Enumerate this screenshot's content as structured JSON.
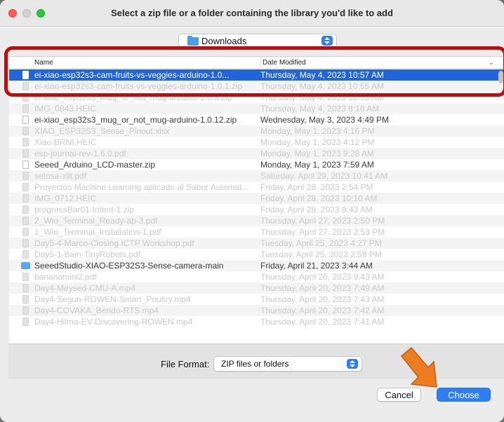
{
  "dialog": {
    "title": "Select a zip file or a folder containing the library you'd like to add"
  },
  "location": {
    "selected": "Downloads",
    "icon": "folder-icon"
  },
  "columns": {
    "name": "Name",
    "date": "Date Modified"
  },
  "files": [
    {
      "name": "ei-xiao-esp32s3-cam-fruits-vs-veggies-arduino-1.0...",
      "date": "Thursday, May 4, 2023 10:57 AM",
      "state": "selected",
      "icon": "zip-file-icon"
    },
    {
      "name": "ei-xiao-esp32s3-cam-fruits-vs-veggies-arduino-1.0.1.zip",
      "date": "Thursday, May 4, 2023 10:55 AM",
      "state": "disabled",
      "icon": "zip-file-icon"
    },
    {
      "name": "ei-xiao_esp32s3_mug_or_not_mug-arduino-1.0.8.zip",
      "date": "Thursday, May 4, 2023 10:53 AM",
      "state": "disabled",
      "icon": "zip-file-icon"
    },
    {
      "name": "IMG_0843.HEIC",
      "date": "Thursday, May 4, 2023 8:18 AM",
      "state": "disabled",
      "icon": "image-file-icon"
    },
    {
      "name": "ei-xiao_esp32s3_mug_or_not_mug-arduino-1.0.12.zip",
      "date": "Wednesday, May 3, 2023 4:49 PM",
      "state": "enabled",
      "icon": "zip-file-icon"
    },
    {
      "name": "XIAO_ESP32S3_Sense_Pinout.xlsx",
      "date": "Monday, May 1, 2023 4:16 PM",
      "state": "disabled",
      "icon": "spreadsheet-file-icon"
    },
    {
      "name": "Xiao-BRNI.HEIC",
      "date": "Monday, May 1, 2023 4:12 PM",
      "state": "disabled",
      "icon": "image-file-icon"
    },
    {
      "name": "esp-journal-rev-1.6.0.pdf",
      "date": "Monday, May 1, 2023 9:28 AM",
      "state": "disabled",
      "icon": "pdf-file-icon"
    },
    {
      "name": "Seeed_Arduino_LCD-master.zip",
      "date": "Monday, May 1, 2023 7:59 AM",
      "state": "enabled",
      "icon": "zip-file-icon"
    },
    {
      "name": "setosa-xiit.pdf",
      "date": "Saturday, April 29, 2023 10:41 AM",
      "state": "disabled",
      "icon": "pdf-file-icon"
    },
    {
      "name": "Proyectos Machine Learning aplicado al Sabor Automat...",
      "date": "Friday, April 28, 2023 2:54 PM",
      "state": "disabled",
      "icon": "document-file-icon"
    },
    {
      "name": "IMG_0712.HEIC",
      "date": "Friday, April 28, 2023 10:10 AM",
      "state": "disabled",
      "icon": "image-file-icon"
    },
    {
      "name": "progressBar01-Intent-1.zip",
      "date": "Friday, April 28, 2023 9:43 AM",
      "state": "disabled",
      "icon": "zip-file-icon"
    },
    {
      "name": "2_Wio_Terminal_Ready-ab-3.pdf",
      "date": "Thursday, April 27, 2023 2:50 PM",
      "state": "disabled",
      "icon": "pdf-file-icon"
    },
    {
      "name": "1_Wio_Terminal_Installation-1.pdf",
      "date": "Thursday, April 27, 2023 2:53 PM",
      "state": "disabled",
      "icon": "pdf-file-icon"
    },
    {
      "name": "Day5-4-Marco-Closing ICTP Workshop.pdf",
      "date": "Tuesday, April 25, 2023 4:27 PM",
      "state": "disabled",
      "icon": "pdf-file-icon"
    },
    {
      "name": "Day5-1-Bain-TinyRobots.pdf",
      "date": "Tuesday, April 25, 2023 2:59 PM",
      "state": "disabled",
      "icon": "pdf-file-icon"
    },
    {
      "name": "SeeedStudio-XIAO-ESP32S3-Sense-camera-main",
      "date": "Friday, April 21, 2023 3:44 AM",
      "state": "enabled",
      "icon": "folder-icon"
    },
    {
      "name": "bananamini2.pdf",
      "date": "Thursday, April 20, 2023 9:43 AM",
      "state": "disabled",
      "icon": "pdf-file-icon"
    },
    {
      "name": "Day4-Meysed-CMU-A.mp4",
      "date": "Thursday, April 20, 2023 7:49 AM",
      "state": "disabled",
      "icon": "video-file-icon"
    },
    {
      "name": "Day4-Segun-ROWEN-Smart_Poultry.mp4",
      "date": "Thursday, April 20, 2023 7:43 AM",
      "state": "disabled",
      "icon": "video-file-icon"
    },
    {
      "name": "Day4-COVAKA_Bendo-RTS.mp4",
      "date": "Thursday, April 20, 2023 7:42 AM",
      "state": "disabled",
      "icon": "video-file-icon"
    },
    {
      "name": "Day4-Hilma-EV-Discovering-ROWEN.mp4",
      "date": "Thursday, April 20, 2023 7:41 AM",
      "state": "disabled",
      "icon": "video-file-icon"
    }
  ],
  "format": {
    "label": "File Format:",
    "value": "ZIP files or folders"
  },
  "buttons": {
    "cancel": "Cancel",
    "choose": "Choose"
  },
  "colors": {
    "selection": "#2265d8",
    "accent": "#2f7ff3",
    "annotation_box": "#bb0e0e",
    "annotation_arrow": "#ee7d22"
  }
}
